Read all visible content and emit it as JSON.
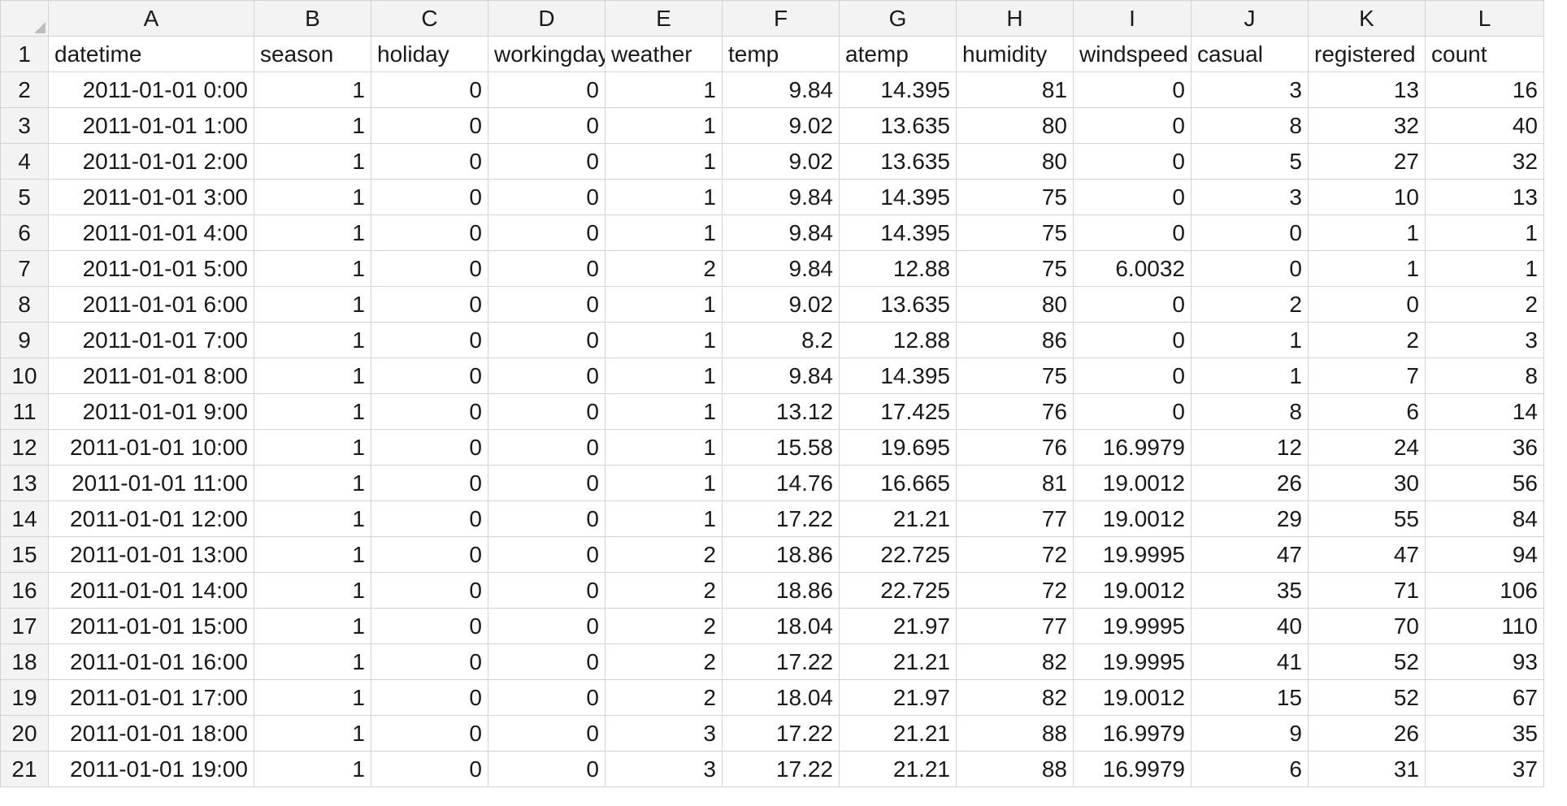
{
  "sheet": {
    "columns": [
      "A",
      "B",
      "C",
      "D",
      "E",
      "F",
      "G",
      "H",
      "I",
      "J",
      "K",
      "L"
    ],
    "header_row_number": "1",
    "headers": [
      "datetime",
      "season",
      "holiday",
      "workingday",
      "weather",
      "temp",
      "atemp",
      "humidity",
      "windspeed",
      "casual",
      "registered",
      "count"
    ],
    "rows": [
      {
        "num": "2",
        "cells": [
          "2011-01-01 0:00",
          "1",
          "0",
          "0",
          "1",
          "9.84",
          "14.395",
          "81",
          "0",
          "3",
          "13",
          "16"
        ]
      },
      {
        "num": "3",
        "cells": [
          "2011-01-01 1:00",
          "1",
          "0",
          "0",
          "1",
          "9.02",
          "13.635",
          "80",
          "0",
          "8",
          "32",
          "40"
        ]
      },
      {
        "num": "4",
        "cells": [
          "2011-01-01 2:00",
          "1",
          "0",
          "0",
          "1",
          "9.02",
          "13.635",
          "80",
          "0",
          "5",
          "27",
          "32"
        ]
      },
      {
        "num": "5",
        "cells": [
          "2011-01-01 3:00",
          "1",
          "0",
          "0",
          "1",
          "9.84",
          "14.395",
          "75",
          "0",
          "3",
          "10",
          "13"
        ]
      },
      {
        "num": "6",
        "cells": [
          "2011-01-01 4:00",
          "1",
          "0",
          "0",
          "1",
          "9.84",
          "14.395",
          "75",
          "0",
          "0",
          "1",
          "1"
        ]
      },
      {
        "num": "7",
        "cells": [
          "2011-01-01 5:00",
          "1",
          "0",
          "0",
          "2",
          "9.84",
          "12.88",
          "75",
          "6.0032",
          "0",
          "1",
          "1"
        ]
      },
      {
        "num": "8",
        "cells": [
          "2011-01-01 6:00",
          "1",
          "0",
          "0",
          "1",
          "9.02",
          "13.635",
          "80",
          "0",
          "2",
          "0",
          "2"
        ]
      },
      {
        "num": "9",
        "cells": [
          "2011-01-01 7:00",
          "1",
          "0",
          "0",
          "1",
          "8.2",
          "12.88",
          "86",
          "0",
          "1",
          "2",
          "3"
        ]
      },
      {
        "num": "10",
        "cells": [
          "2011-01-01 8:00",
          "1",
          "0",
          "0",
          "1",
          "9.84",
          "14.395",
          "75",
          "0",
          "1",
          "7",
          "8"
        ]
      },
      {
        "num": "11",
        "cells": [
          "2011-01-01 9:00",
          "1",
          "0",
          "0",
          "1",
          "13.12",
          "17.425",
          "76",
          "0",
          "8",
          "6",
          "14"
        ]
      },
      {
        "num": "12",
        "cells": [
          "2011-01-01 10:00",
          "1",
          "0",
          "0",
          "1",
          "15.58",
          "19.695",
          "76",
          "16.9979",
          "12",
          "24",
          "36"
        ]
      },
      {
        "num": "13",
        "cells": [
          "2011-01-01 11:00",
          "1",
          "0",
          "0",
          "1",
          "14.76",
          "16.665",
          "81",
          "19.0012",
          "26",
          "30",
          "56"
        ]
      },
      {
        "num": "14",
        "cells": [
          "2011-01-01 12:00",
          "1",
          "0",
          "0",
          "1",
          "17.22",
          "21.21",
          "77",
          "19.0012",
          "29",
          "55",
          "84"
        ]
      },
      {
        "num": "15",
        "cells": [
          "2011-01-01 13:00",
          "1",
          "0",
          "0",
          "2",
          "18.86",
          "22.725",
          "72",
          "19.9995",
          "47",
          "47",
          "94"
        ]
      },
      {
        "num": "16",
        "cells": [
          "2011-01-01 14:00",
          "1",
          "0",
          "0",
          "2",
          "18.86",
          "22.725",
          "72",
          "19.0012",
          "35",
          "71",
          "106"
        ]
      },
      {
        "num": "17",
        "cells": [
          "2011-01-01 15:00",
          "1",
          "0",
          "0",
          "2",
          "18.04",
          "21.97",
          "77",
          "19.9995",
          "40",
          "70",
          "110"
        ]
      },
      {
        "num": "18",
        "cells": [
          "2011-01-01 16:00",
          "1",
          "0",
          "0",
          "2",
          "17.22",
          "21.21",
          "82",
          "19.9995",
          "41",
          "52",
          "93"
        ]
      },
      {
        "num": "19",
        "cells": [
          "2011-01-01 17:00",
          "1",
          "0",
          "0",
          "2",
          "18.04",
          "21.97",
          "82",
          "19.0012",
          "15",
          "52",
          "67"
        ]
      },
      {
        "num": "20",
        "cells": [
          "2011-01-01 18:00",
          "1",
          "0",
          "0",
          "3",
          "17.22",
          "21.21",
          "88",
          "16.9979",
          "9",
          "26",
          "35"
        ]
      },
      {
        "num": "21",
        "cells": [
          "2011-01-01 19:00",
          "1",
          "0",
          "0",
          "3",
          "17.22",
          "21.21",
          "88",
          "16.9979",
          "6",
          "31",
          "37"
        ]
      }
    ]
  }
}
